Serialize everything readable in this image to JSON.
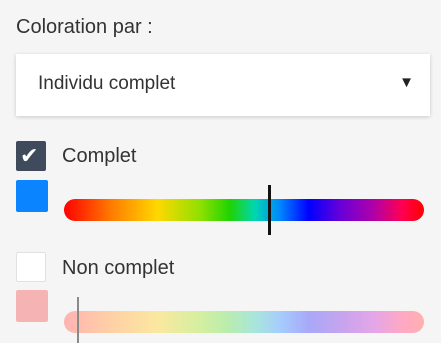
{
  "color_by": {
    "label": "Coloration par :",
    "selected": "Individu complet",
    "caret": "▼"
  },
  "options": [
    {
      "label": "Complet",
      "checked": true,
      "check_glyph": "✔",
      "swatch_color": "#0a84ff",
      "gradient": "rainbow",
      "marker_position": 0.57
    },
    {
      "label": "Non complet",
      "checked": false,
      "swatch_color": "#f6b3b3",
      "gradient": "rainbow-faded",
      "marker_position": 0.04
    }
  ]
}
